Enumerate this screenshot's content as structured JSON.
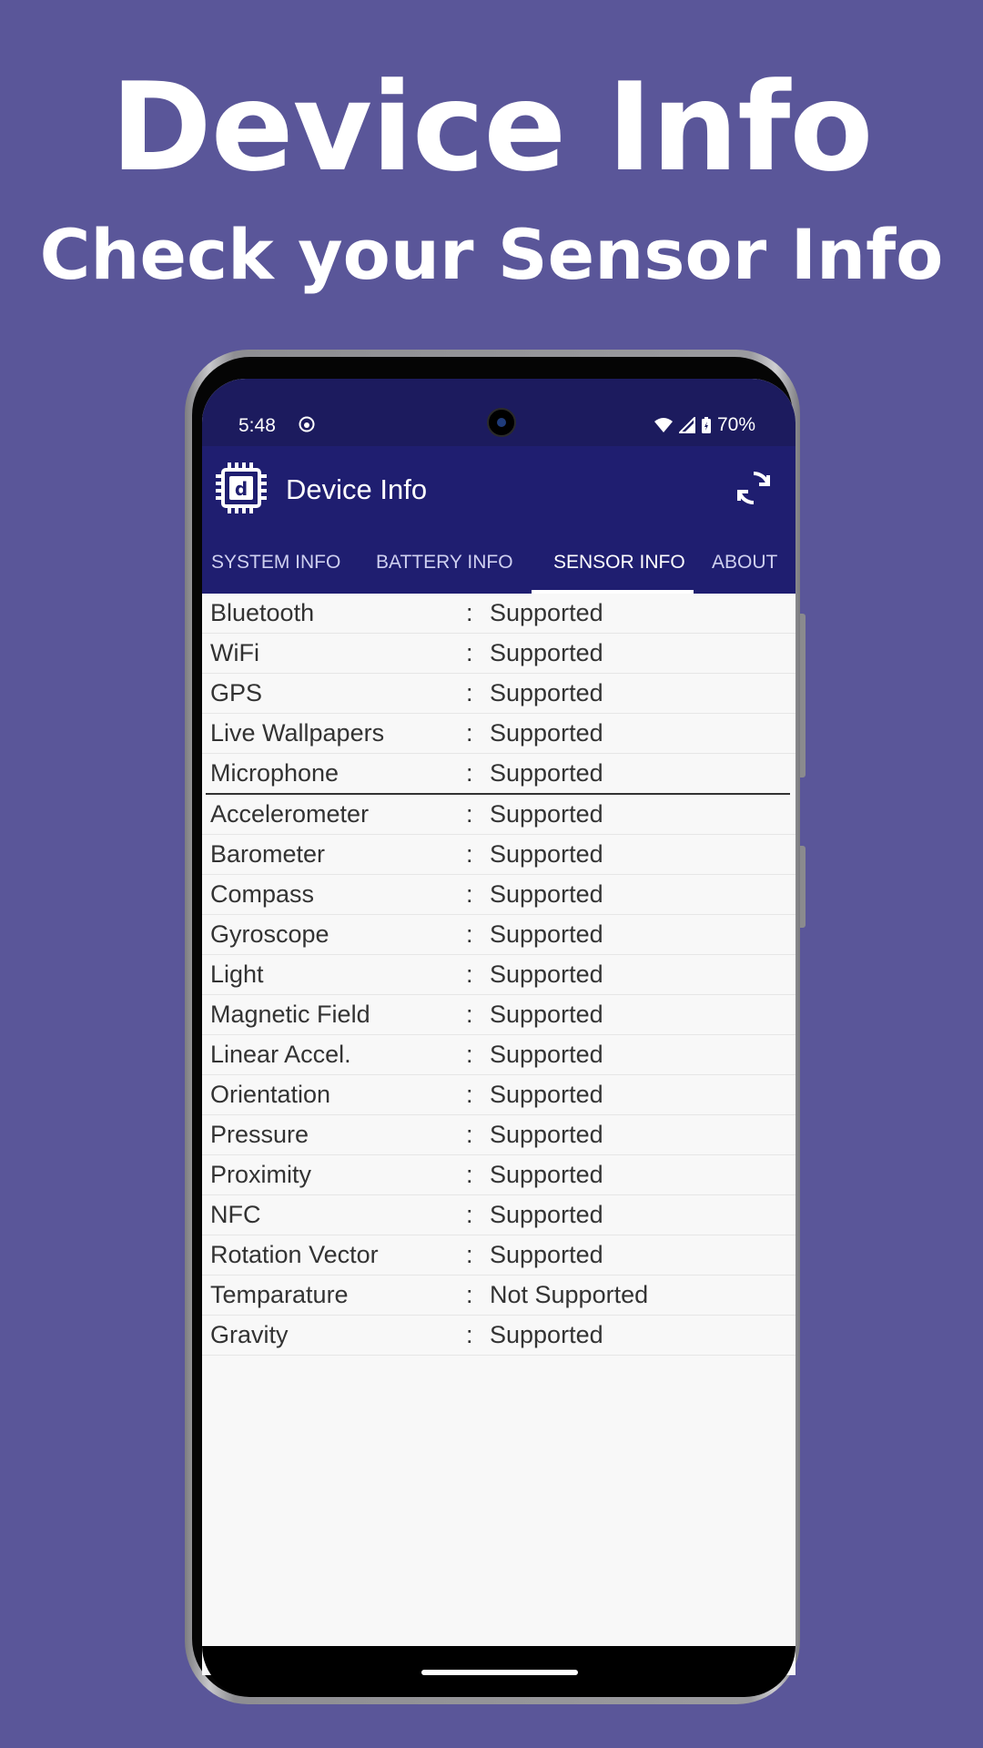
{
  "promo": {
    "title": "Device Info",
    "subtitle": "Check your Sensor Info"
  },
  "statusbar": {
    "time": "5:48",
    "battery": "70%",
    "icons": [
      "notification-icon",
      "wifi-icon",
      "signal-icon",
      "battery-charging-icon"
    ]
  },
  "appbar": {
    "title": "Device Info",
    "logo_icon": "chip-d-logo",
    "refresh_icon": "refresh-icon",
    "color": "#1f1e70"
  },
  "tabs": [
    {
      "label": "SYSTEM INFO"
    },
    {
      "label": "BATTERY INFO"
    },
    {
      "label": "SENSOR INFO",
      "selected": true
    },
    {
      "label": "ABOUT"
    }
  ],
  "features": [
    {
      "name": "Bluetooth",
      "sep": ":",
      "value": "Supported"
    },
    {
      "name": "WiFi",
      "sep": ":",
      "value": "Supported"
    },
    {
      "name": "GPS",
      "sep": ":",
      "value": "Supported"
    },
    {
      "name": "Live Wallpapers",
      "sep": ":",
      "value": "Supported"
    },
    {
      "name": "Microphone",
      "sep": ":",
      "value": "Supported"
    }
  ],
  "sensors": [
    {
      "name": "Accelerometer",
      "sep": ":",
      "value": "Supported"
    },
    {
      "name": "Barometer",
      "sep": ":",
      "value": "Supported"
    },
    {
      "name": "Compass",
      "sep": ":",
      "value": "Supported"
    },
    {
      "name": "Gyroscope",
      "sep": ":",
      "value": "Supported"
    },
    {
      "name": "Light",
      "sep": ":",
      "value": "Supported"
    },
    {
      "name": "Magnetic Field",
      "sep": ":",
      "value": "Supported"
    },
    {
      "name": "Linear Accel.",
      "sep": ":",
      "value": "Supported"
    },
    {
      "name": "Orientation",
      "sep": ":",
      "value": "Supported"
    },
    {
      "name": "Pressure",
      "sep": ":",
      "value": "Supported"
    },
    {
      "name": "Proximity",
      "sep": ":",
      "value": "Supported"
    },
    {
      "name": "NFC",
      "sep": ":",
      "value": "Supported"
    },
    {
      "name": "Rotation Vector",
      "sep": ":",
      "value": "Supported"
    },
    {
      "name": "Temparature",
      "sep": ":",
      "value": "Not Supported"
    },
    {
      "name": "Gravity",
      "sep": ":",
      "value": "Supported"
    }
  ]
}
